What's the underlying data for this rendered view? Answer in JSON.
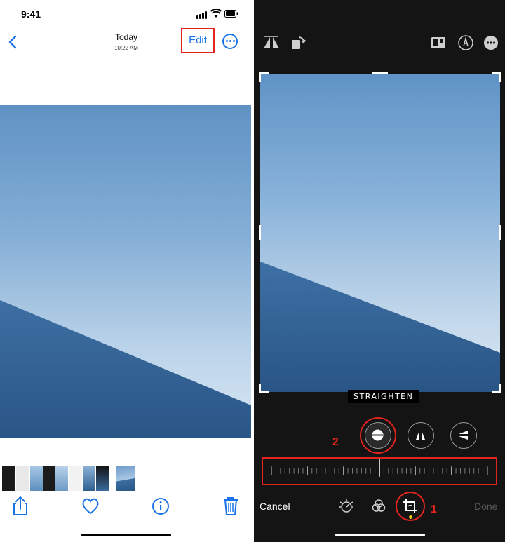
{
  "left": {
    "status": {
      "time": "9:41"
    },
    "nav": {
      "title": "Today",
      "subtitle": "10:22 AM",
      "edit_label": "Edit"
    }
  },
  "right": {
    "adjust_label": "STRAIGHTEN",
    "cancel_label": "Cancel",
    "done_label": "Done",
    "callouts": {
      "step1": "1",
      "step2": "2"
    }
  },
  "colors": {
    "accent": "#1a73e8",
    "annotation": "#e3231e",
    "editor_bg": "#141414",
    "crop_indicator": "#f2c300"
  },
  "icons": {
    "left_toolbar": [
      "share-icon",
      "heart-icon",
      "info-icon",
      "trash-icon"
    ],
    "right_top": [
      "flip-icon",
      "rotate-icon",
      "aspect-ratio-icon",
      "markup-icon",
      "more-icon"
    ],
    "right_bottom": [
      "adjust-icon",
      "filters-icon",
      "crop-icon"
    ],
    "adjust_modes": [
      "straighten-icon",
      "vertical-perspective-icon",
      "horizontal-perspective-icon"
    ]
  }
}
